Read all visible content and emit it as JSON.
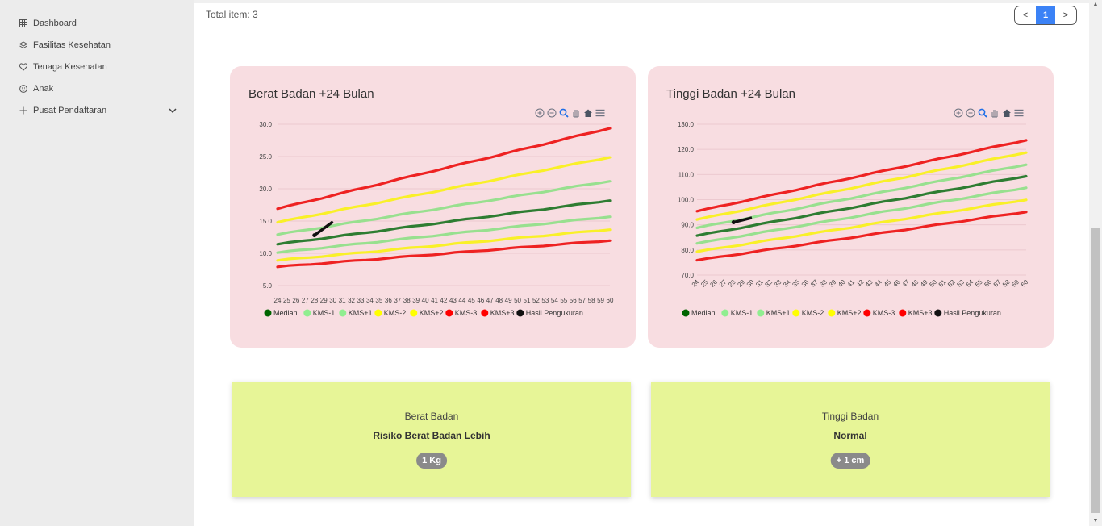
{
  "sidebar": {
    "items": [
      {
        "label": "Dashboard",
        "icon": "grid-icon"
      },
      {
        "label": "Fasilitas Kesehatan",
        "icon": "layers-icon"
      },
      {
        "label": "Tenaga Kesehatan",
        "icon": "heart-icon"
      },
      {
        "label": "Anak",
        "icon": "smile-icon"
      },
      {
        "label": "Pusat Pendaftaran",
        "icon": "plus-icon"
      }
    ]
  },
  "list": {
    "total_label": "Total item: 3",
    "pagination": {
      "prev": "<",
      "current": "1",
      "next": ">"
    }
  },
  "toolbar_icons": [
    "zoom-in-icon",
    "zoom-out-icon",
    "zoom-select-icon",
    "pan-icon",
    "home-icon",
    "menu-icon"
  ],
  "chart_data": [
    {
      "type": "line",
      "title": "Berat Badan +24 Bulan",
      "x": [
        24,
        25,
        26,
        27,
        28,
        29,
        30,
        31,
        32,
        33,
        34,
        35,
        36,
        37,
        38,
        39,
        40,
        41,
        42,
        43,
        44,
        45,
        46,
        47,
        48,
        49,
        50,
        51,
        52,
        53,
        54,
        55,
        56,
        57,
        58,
        59,
        60
      ],
      "ylim": [
        5,
        30
      ],
      "yticks": [
        "30.0",
        "25.0",
        "20.0",
        "15.0",
        "10.0",
        "5.0"
      ],
      "series": [
        {
          "name": "Median",
          "color": "#2e7d32",
          "start": 11.4,
          "end": 18.2
        },
        {
          "name": "KMS-1",
          "color": "#98e08f",
          "start": 10.1,
          "end": 15.7
        },
        {
          "name": "KMS+1",
          "color": "#98e08f",
          "start": 12.9,
          "end": 21.2
        },
        {
          "name": "KMS-2",
          "color": "#f9f028",
          "start": 8.9,
          "end": 13.7
        },
        {
          "name": "KMS+2",
          "color": "#f9f028",
          "start": 14.8,
          "end": 24.9
        },
        {
          "name": "KMS-3",
          "color": "#ee2222",
          "start": 7.9,
          "end": 12.0
        },
        {
          "name": "KMS+3",
          "color": "#ee2222",
          "start": 16.9,
          "end": 29.4
        },
        {
          "name": "Hasil Pengukuran",
          "color": "#111111",
          "points": [
            [
              28,
              12.8
            ],
            [
              30,
              14.9
            ]
          ]
        }
      ],
      "legend_position": "bottom"
    },
    {
      "type": "line",
      "title": "Tinggi Badan +24 Bulan",
      "x": [
        24,
        25,
        26,
        27,
        28,
        29,
        30,
        31,
        32,
        33,
        34,
        35,
        36,
        37,
        38,
        39,
        40,
        41,
        42,
        43,
        44,
        45,
        46,
        47,
        48,
        49,
        50,
        51,
        52,
        53,
        54,
        55,
        56,
        57,
        58,
        59,
        60
      ],
      "ylim": [
        70,
        130
      ],
      "yticks": [
        "130.0",
        "120.0",
        "110.0",
        "100.0",
        "90.0",
        "80.0",
        "70.0"
      ],
      "series": [
        {
          "name": "Median",
          "color": "#2e7d32",
          "start": 85.7,
          "end": 109.4
        },
        {
          "name": "KMS-1",
          "color": "#98e08f",
          "start": 82.6,
          "end": 104.8
        },
        {
          "name": "KMS+1",
          "color": "#98e08f",
          "start": 88.8,
          "end": 114.0
        },
        {
          "name": "KMS-2",
          "color": "#f9f028",
          "start": 79.3,
          "end": 100.0
        },
        {
          "name": "KMS+2",
          "color": "#f9f028",
          "start": 92.1,
          "end": 118.8
        },
        {
          "name": "KMS-3",
          "color": "#ee2222",
          "start": 75.9,
          "end": 95.2
        },
        {
          "name": "KMS+3",
          "color": "#ee2222",
          "start": 95.4,
          "end": 123.7
        },
        {
          "name": "Hasil Pengukuran",
          "color": "#111111",
          "points": [
            [
              28,
              91.0
            ],
            [
              30,
              92.8
            ]
          ]
        }
      ],
      "legend_position": "bottom"
    }
  ],
  "results": [
    {
      "label": "Berat Badan",
      "status": "Risiko Berat Badan Lebih",
      "badge": "1 Kg"
    },
    {
      "label": "Tinggi Badan",
      "status": "Normal",
      "badge": "+ 1 cm"
    }
  ]
}
